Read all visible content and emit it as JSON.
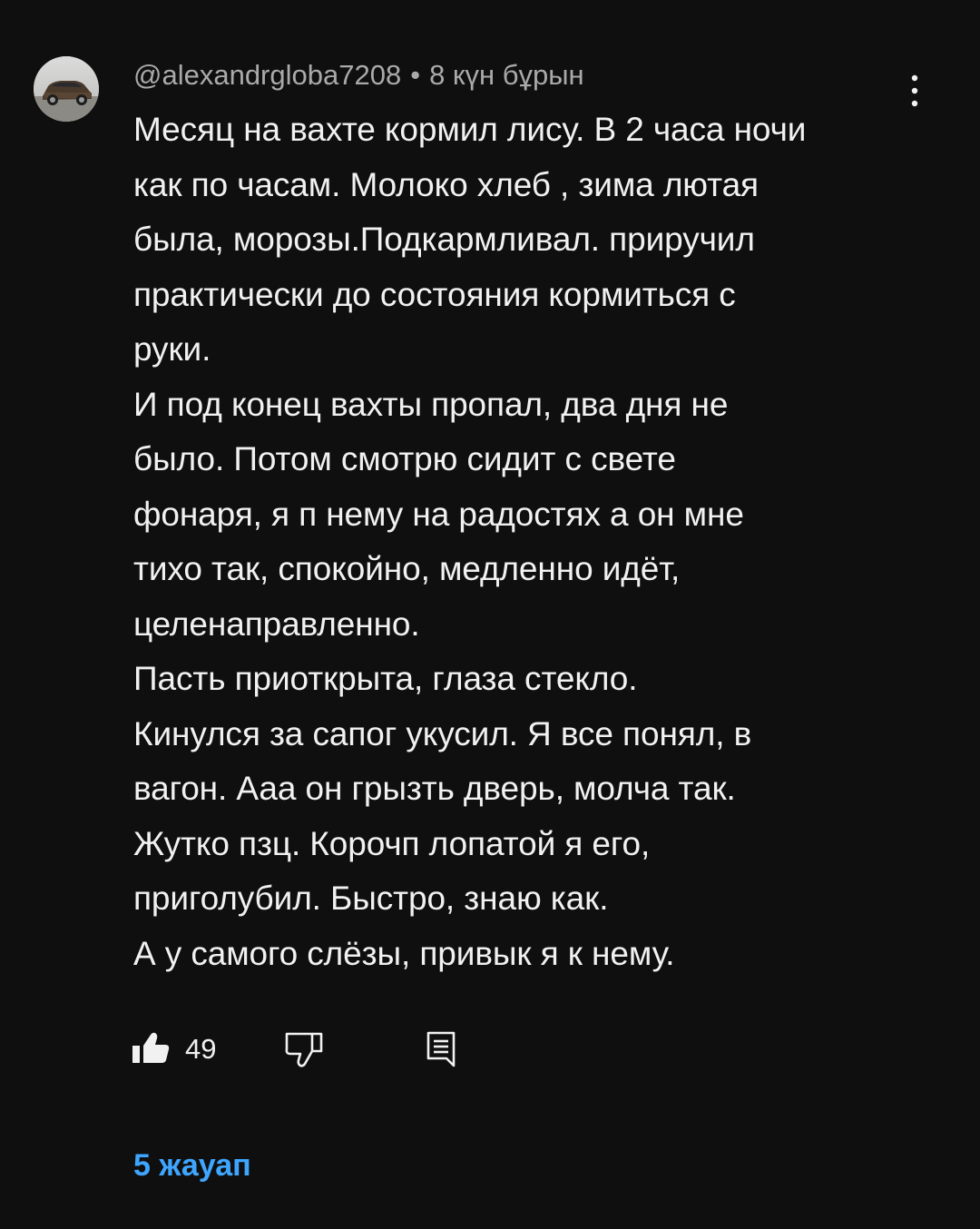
{
  "comment": {
    "author": "@alexandrgloba7208",
    "separator": "•",
    "time": "8 күн бұрын",
    "lines": [
      "Месяц на вахте кормил лису. В 2 часа ночи",
      "как по часам. Молоко хлеб , зима лютая",
      "была, морозы.Подкармливал. приручил",
      "практически до состояния кормиться с",
      "руки.",
      "И под конец вахты пропал, два дня не",
      "было. Потом смотрю сидит с свете",
      "фонаря, я п нему на радостях а он мне",
      "тихо так, спокойно, медленно идёт,",
      "целенаправленно.",
      "Пасть приоткрыта, глаза стекло.",
      "Кинулся за сапог укусил. Я все понял, в",
      "вагон. Ааа он грызть дверь, молча так.",
      "Жутко пзц. Корочп лопатой я его,",
      "приголубил. Быстро, знаю как.",
      "А у самого слёзы, привык я к нему."
    ],
    "like_count": "49",
    "replies_label": "5 жауап"
  },
  "icons": {
    "avatar": "avatar-car-image",
    "more": "more-vert-icon",
    "like": "thumb-up-icon",
    "dislike": "thumb-down-icon",
    "reply": "reply-comment-icon"
  },
  "colors": {
    "background": "#0f0f0f",
    "text": "#f1f1f1",
    "meta": "#aaaaaa",
    "link": "#3ea6ff"
  }
}
